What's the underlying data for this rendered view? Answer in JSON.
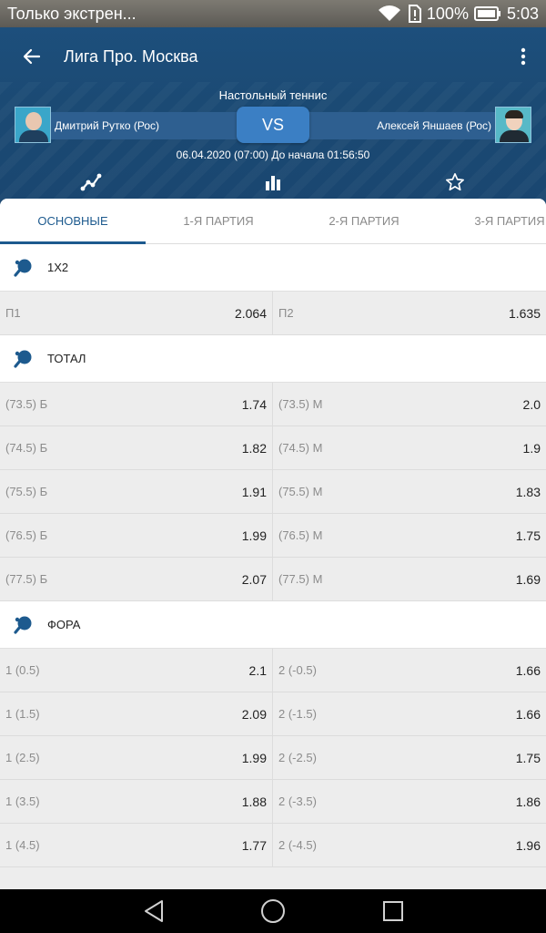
{
  "status_bar": {
    "notification": "Только экстрен...",
    "battery": "100%",
    "time": "5:03"
  },
  "header": {
    "title": "Лига Про. Москва",
    "sport": "Настольный теннис",
    "player_left": "Дмитрий Рутко (Рос)",
    "player_right": "Алексей Яншаев (Рос)",
    "vs": "VS",
    "datetime": "06.04.2020 (07:00) До начала 01:56:50"
  },
  "tabs": [
    "ОСНОВНЫЕ",
    "1-Я ПАРТИЯ",
    "2-Я ПАРТИЯ",
    "3-Я ПАРТИЯ"
  ],
  "active_tab": "ОСНОВНЫЕ",
  "sections": [
    {
      "title": "1X2",
      "rows": [
        {
          "left_label": "П1",
          "left_value": "2.064",
          "right_label": "П2",
          "right_value": "1.635"
        }
      ]
    },
    {
      "title": "ТОТАЛ",
      "rows": [
        {
          "left_label": "(73.5) Б",
          "left_value": "1.74",
          "right_label": "(73.5) М",
          "right_value": "2.0"
        },
        {
          "left_label": "(74.5) Б",
          "left_value": "1.82",
          "right_label": "(74.5) М",
          "right_value": "1.9"
        },
        {
          "left_label": "(75.5) Б",
          "left_value": "1.91",
          "right_label": "(75.5) М",
          "right_value": "1.83"
        },
        {
          "left_label": "(76.5) Б",
          "left_value": "1.99",
          "right_label": "(76.5) М",
          "right_value": "1.75"
        },
        {
          "left_label": "(77.5) Б",
          "left_value": "2.07",
          "right_label": "(77.5) М",
          "right_value": "1.69"
        }
      ]
    },
    {
      "title": "ФОРА",
      "rows": [
        {
          "left_label": "1 (0.5)",
          "left_value": "2.1",
          "right_label": "2 (-0.5)",
          "right_value": "1.66"
        },
        {
          "left_label": "1 (1.5)",
          "left_value": "2.09",
          "right_label": "2 (-1.5)",
          "right_value": "1.66"
        },
        {
          "left_label": "1 (2.5)",
          "left_value": "1.99",
          "right_label": "2 (-2.5)",
          "right_value": "1.75"
        },
        {
          "left_label": "1 (3.5)",
          "left_value": "1.88",
          "right_label": "2 (-3.5)",
          "right_value": "1.86"
        },
        {
          "left_label": "1 (4.5)",
          "left_value": "1.77",
          "right_label": "2 (-4.5)",
          "right_value": "1.96"
        }
      ]
    }
  ],
  "colors": {
    "header": "#1b4a74",
    "accent": "#1d5a8e",
    "vs_button": "#3b7fc4"
  }
}
